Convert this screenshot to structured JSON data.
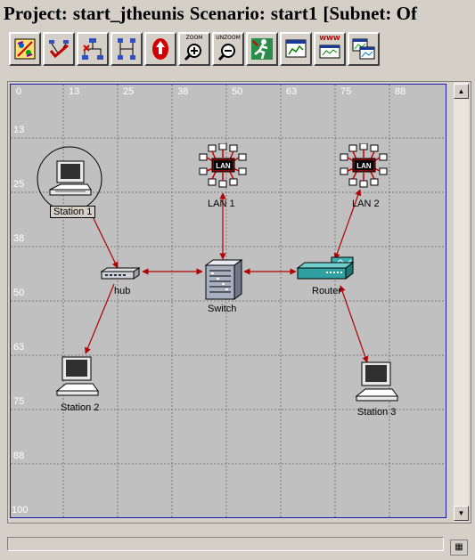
{
  "title": {
    "project_label": "Project:",
    "project_name": "start_jtheunis",
    "scenario_label": "Scenario:",
    "scenario_name": "start1",
    "subnet_text": "[Subnet: Of"
  },
  "toolbar": {
    "zoom_label": "ZOOM",
    "unzoom_label": "UNZOOM",
    "www_label": "WWW"
  },
  "grid": {
    "x_ticks": [
      "0",
      "13",
      "25",
      "38",
      "50",
      "63",
      "75",
      "88"
    ],
    "y_ticks": [
      "13",
      "25",
      "38",
      "50",
      "63",
      "75",
      "88",
      "100"
    ]
  },
  "nodes": {
    "station1": "Station 1",
    "station2": "Station 2",
    "station3": "Station 3",
    "hub": "hub",
    "switch": "Switch",
    "router": "Router",
    "lan1": "LAN 1",
    "lan2": "LAN 2",
    "lan_badge": "LAN"
  },
  "colors": {
    "canvas": "#c0c0c0",
    "grid": "#7a7a7a",
    "link": "#b00000",
    "border": "#1a1aa8"
  }
}
